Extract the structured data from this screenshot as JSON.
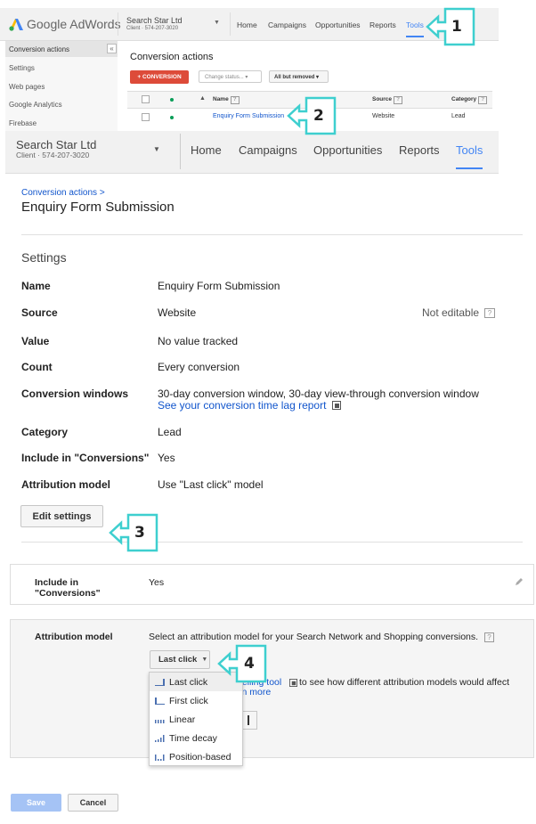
{
  "p1": {
    "brand": "Google AdWords",
    "account_name": "Search Star Ltd",
    "account_sub": "Client · 574-207-3020",
    "nav": [
      "Home",
      "Campaigns",
      "Opportunities",
      "Reports",
      "Tools"
    ],
    "sidebar": [
      "Conversion actions",
      "Settings",
      "Web pages",
      "Google Analytics",
      "Firebase"
    ],
    "collapse_glyph": "«",
    "page_title": "Conversion actions",
    "new_button": "+ CONVERSION",
    "status_filter": "Change status...",
    "removed_filter": "All but removed",
    "table_headers": [
      "Name",
      "Source",
      "Category"
    ],
    "row": {
      "name": "Enquiry Form Submission",
      "source": "Website",
      "category": "Lead"
    }
  },
  "header": {
    "account_name": "Search Star Ltd",
    "account_sub": "Client  ·  574-207-3020",
    "nav": [
      "Home",
      "Campaigns",
      "Opportunities",
      "Reports",
      "Tools"
    ]
  },
  "breadcrumb": "Conversion actions >",
  "page_title": "Enquiry Form Submission",
  "settings": {
    "heading": "Settings",
    "rows": [
      {
        "label": "Name",
        "value": "Enquiry Form Submission"
      },
      {
        "label": "Source",
        "value": "Website",
        "note": "Not editable"
      },
      {
        "label": "Value",
        "value": "No value tracked"
      },
      {
        "label": "Count",
        "value": "Every conversion"
      },
      {
        "label": "Conversion windows",
        "value": "30-day conversion window, 30-day view-through conversion window",
        "link": "See your conversion time lag report"
      },
      {
        "label": "Category",
        "value": "Lead"
      },
      {
        "label": "Include in \"Conversions\"",
        "value": "Yes"
      },
      {
        "label": "Attribution model",
        "value": "Use \"Last click\" model"
      }
    ],
    "edit_button": "Edit settings"
  },
  "edit_panel": {
    "include_label": "Include in \"Conversions\"",
    "include_value": "Yes",
    "attr_label": "Attribution model",
    "attr_text": "Select an attribution model for your Search Network and Shopping conversions.",
    "dropdown_value": "Last click",
    "behind_text_1": "delling tool",
    "behind_text_2": "to see how different attribution models would affect",
    "behind_text_3": "rn more",
    "menu_options": [
      "Last click",
      "First click",
      "Linear",
      "Time decay",
      "Position-based"
    ]
  },
  "footer": {
    "save": "Save",
    "cancel": "Cancel"
  },
  "callouts": [
    "1",
    "2",
    "3",
    "4"
  ],
  "colors": {
    "accent": "#4285f4",
    "link": "#1155cc",
    "callout": "#3ecfcf",
    "red_button": "#dd4b39",
    "save_button": "#a5c3f5"
  }
}
